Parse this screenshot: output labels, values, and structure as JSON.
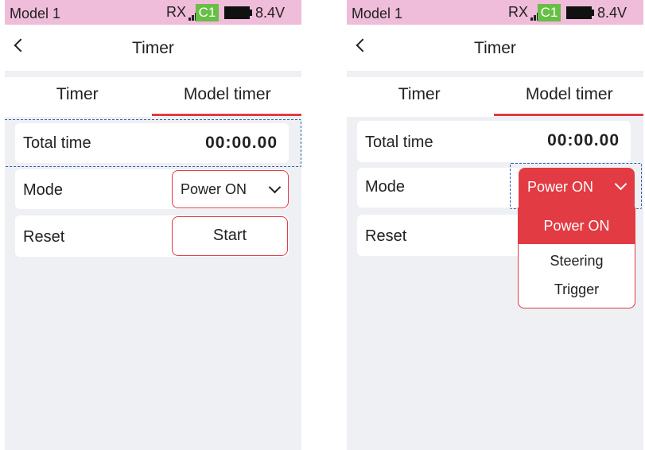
{
  "status": {
    "model": "Model 1",
    "rx": "RX",
    "channel_badge": "C1",
    "voltage": "8.4V",
    "icons": [
      "signal-icon",
      "battery-icon"
    ],
    "colors": {
      "bar": "#efbcd9",
      "badge": "#67bf45"
    }
  },
  "nav": {
    "title": "Timer",
    "back_icon": "back-chevron-icon"
  },
  "tabs": [
    {
      "label": "Timer",
      "active": false
    },
    {
      "label": "Model timer",
      "active": true
    }
  ],
  "rows": {
    "total_time": {
      "label": "Total time",
      "value": "00:00.00"
    },
    "mode": {
      "label": "Mode",
      "value": "Power ON"
    },
    "reset": {
      "label": "Reset",
      "button": "Start"
    }
  },
  "mode_options": [
    "Power ON",
    "Steering",
    "Trigger"
  ],
  "colors": {
    "accent": "#e23b43",
    "background": "#eef0f4",
    "focus": "#3060a8"
  }
}
